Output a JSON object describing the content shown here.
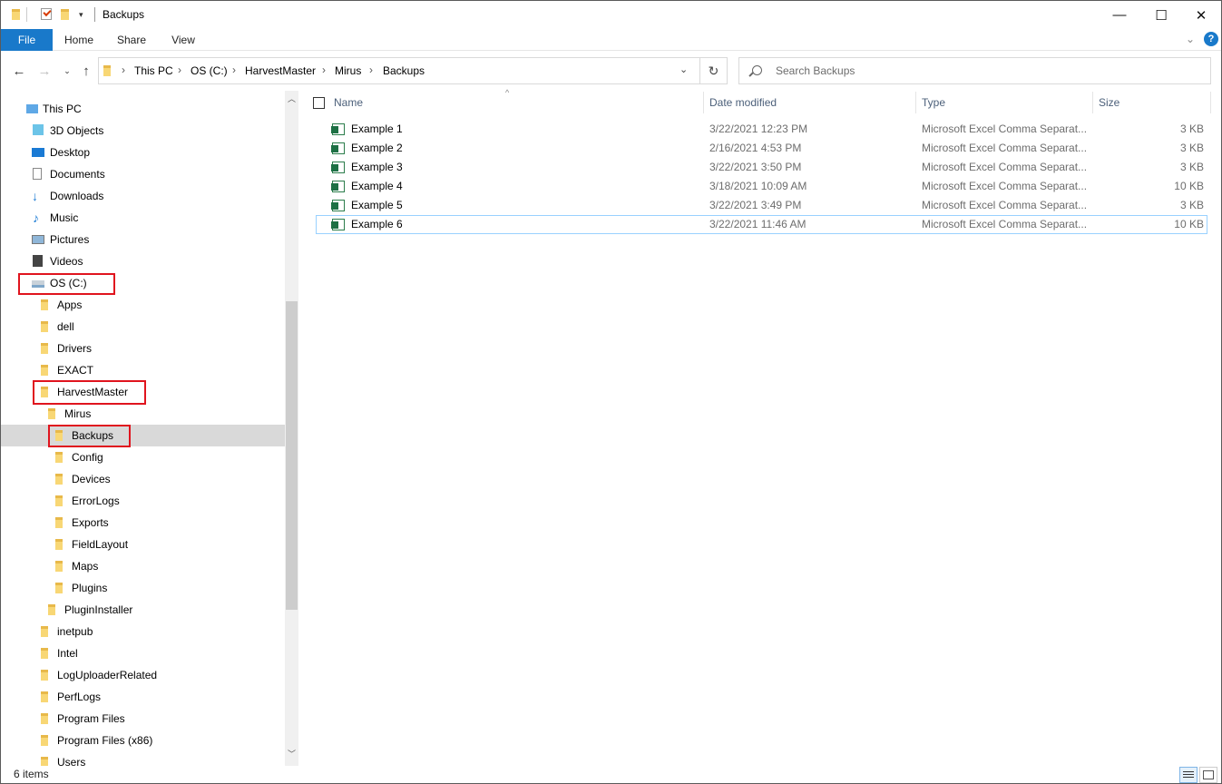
{
  "window": {
    "title": "Backups"
  },
  "ribbon": {
    "tabs": [
      "File",
      "Home",
      "Share",
      "View"
    ]
  },
  "address": {
    "crumbs": [
      "This PC",
      "OS (C:)",
      "HarvestMaster",
      "Mirus",
      "Backups"
    ],
    "search_placeholder": "Search Backups"
  },
  "nav": {
    "items": [
      {
        "label": "This PC",
        "icon": "pc-icon"
      },
      {
        "label": "3D Objects",
        "icon": "3d-objects-icon"
      },
      {
        "label": "Desktop",
        "icon": "desktop-icon"
      },
      {
        "label": "Documents",
        "icon": "documents-icon"
      },
      {
        "label": "Downloads",
        "icon": "download-arrow-icon"
      },
      {
        "label": "Music",
        "icon": "music-note-icon"
      },
      {
        "label": "Pictures",
        "icon": "pictures-icon"
      },
      {
        "label": "Videos",
        "icon": "videos-icon"
      },
      {
        "label": "OS (C:)",
        "icon": "drive-icon"
      },
      {
        "label": "Apps",
        "icon": "folder-icon"
      },
      {
        "label": "dell",
        "icon": "folder-icon"
      },
      {
        "label": "Drivers",
        "icon": "folder-icon"
      },
      {
        "label": "EXACT",
        "icon": "folder-icon"
      },
      {
        "label": "HarvestMaster",
        "icon": "folder-icon"
      },
      {
        "label": "Mirus",
        "icon": "folder-icon"
      },
      {
        "label": "Backups",
        "icon": "folder-icon"
      },
      {
        "label": "Config",
        "icon": "folder-icon"
      },
      {
        "label": "Devices",
        "icon": "folder-icon"
      },
      {
        "label": "ErrorLogs",
        "icon": "folder-icon"
      },
      {
        "label": "Exports",
        "icon": "folder-icon"
      },
      {
        "label": "FieldLayout",
        "icon": "folder-icon"
      },
      {
        "label": "Maps",
        "icon": "folder-icon"
      },
      {
        "label": "Plugins",
        "icon": "folder-icon"
      },
      {
        "label": "PluginInstaller",
        "icon": "folder-icon"
      },
      {
        "label": "inetpub",
        "icon": "folder-icon"
      },
      {
        "label": "Intel",
        "icon": "folder-icon"
      },
      {
        "label": "LogUploaderRelated",
        "icon": "folder-icon"
      },
      {
        "label": "PerfLogs",
        "icon": "folder-icon"
      },
      {
        "label": "Program Files",
        "icon": "folder-icon"
      },
      {
        "label": "Program Files (x86)",
        "icon": "folder-icon"
      },
      {
        "label": "Users",
        "icon": "folder-icon"
      }
    ],
    "selected": "Backups",
    "highlighted": [
      "OS (C:)",
      "HarvestMaster",
      "Backups"
    ],
    "highlight_color": "#e0141e"
  },
  "columns": {
    "name": "Name",
    "date": "Date modified",
    "type": "Type",
    "size": "Size"
  },
  "files": [
    {
      "name": "Example 1",
      "date": "3/22/2021 12:23 PM",
      "type": "Microsoft Excel Comma Separat...",
      "size": "3 KB"
    },
    {
      "name": "Example 2",
      "date": "2/16/2021 4:53 PM",
      "type": "Microsoft Excel Comma Separat...",
      "size": "3 KB"
    },
    {
      "name": "Example 3",
      "date": "3/22/2021 3:50 PM",
      "type": "Microsoft Excel Comma Separat...",
      "size": "3 KB"
    },
    {
      "name": "Example 4",
      "date": "3/18/2021 10:09 AM",
      "type": "Microsoft Excel Comma Separat...",
      "size": "10 KB"
    },
    {
      "name": "Example 5",
      "date": "3/22/2021 3:49 PM",
      "type": "Microsoft Excel Comma Separat...",
      "size": "3 KB"
    },
    {
      "name": "Example 6",
      "date": "3/22/2021 11:46 AM",
      "type": "Microsoft Excel Comma Separat...",
      "size": "10 KB"
    }
  ],
  "status": {
    "count": "6 items"
  }
}
